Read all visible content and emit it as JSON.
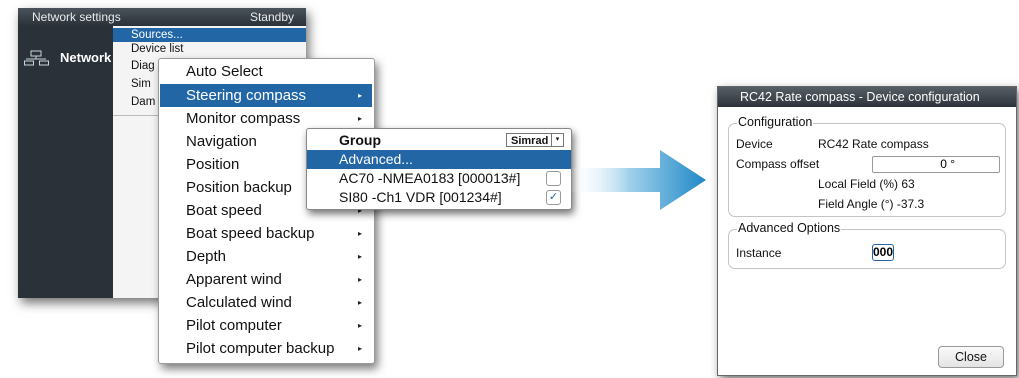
{
  "network_window": {
    "title": "Network settings",
    "status": "Standby",
    "nav_label": "Network",
    "items": [
      "Sources...",
      "Device list",
      "Diag",
      "Sim",
      "Dam"
    ]
  },
  "sources_menu": {
    "items": [
      {
        "label": "Auto Select",
        "has_submenu": false
      },
      {
        "label": "Steering compass",
        "has_submenu": true,
        "selected": true
      },
      {
        "label": "Monitor compass",
        "has_submenu": true
      },
      {
        "label": "Navigation",
        "has_submenu": true
      },
      {
        "label": "Position",
        "has_submenu": true
      },
      {
        "label": "Position backup",
        "has_submenu": true
      },
      {
        "label": "Boat speed",
        "has_submenu": true
      },
      {
        "label": "Boat speed backup",
        "has_submenu": true
      },
      {
        "label": "Depth",
        "has_submenu": true
      },
      {
        "label": "Apparent wind",
        "has_submenu": true
      },
      {
        "label": "Calculated wind",
        "has_submenu": true
      },
      {
        "label": "Pilot computer",
        "has_submenu": true
      },
      {
        "label": "Pilot computer backup",
        "has_submenu": true
      }
    ],
    "submenu_arrow": "▸"
  },
  "device_popup": {
    "group_label": "Group",
    "group_value": "Simrad",
    "group_arrow": "▾",
    "advanced_label": "Advanced...",
    "devices": [
      {
        "label": "AC70 -NMEA0183 [000013#]",
        "checked": false,
        "mark": ""
      },
      {
        "label": "SI80 -Ch1 VDR [001234#]",
        "checked": true,
        "mark": "✓"
      }
    ]
  },
  "config_dialog": {
    "title": "RC42 Rate compass - Device configuration",
    "configuration_legend": "Configuration",
    "device_label": "Device",
    "device_value": "RC42 Rate compass",
    "compass_offset_label": "Compass offset",
    "compass_offset_value": "0 °",
    "local_field": "Local Field (%) 63",
    "field_angle": "Field Angle (°) -37.3",
    "advanced_legend": "Advanced Options",
    "instance_label": "Instance",
    "instance_value": "000",
    "close_label": "Close"
  },
  "colors": {
    "accent": "#2266a6",
    "dark_panel": "#2a3139",
    "arrow_light": "#dff1f9",
    "arrow_dark": "#1e88c7"
  }
}
